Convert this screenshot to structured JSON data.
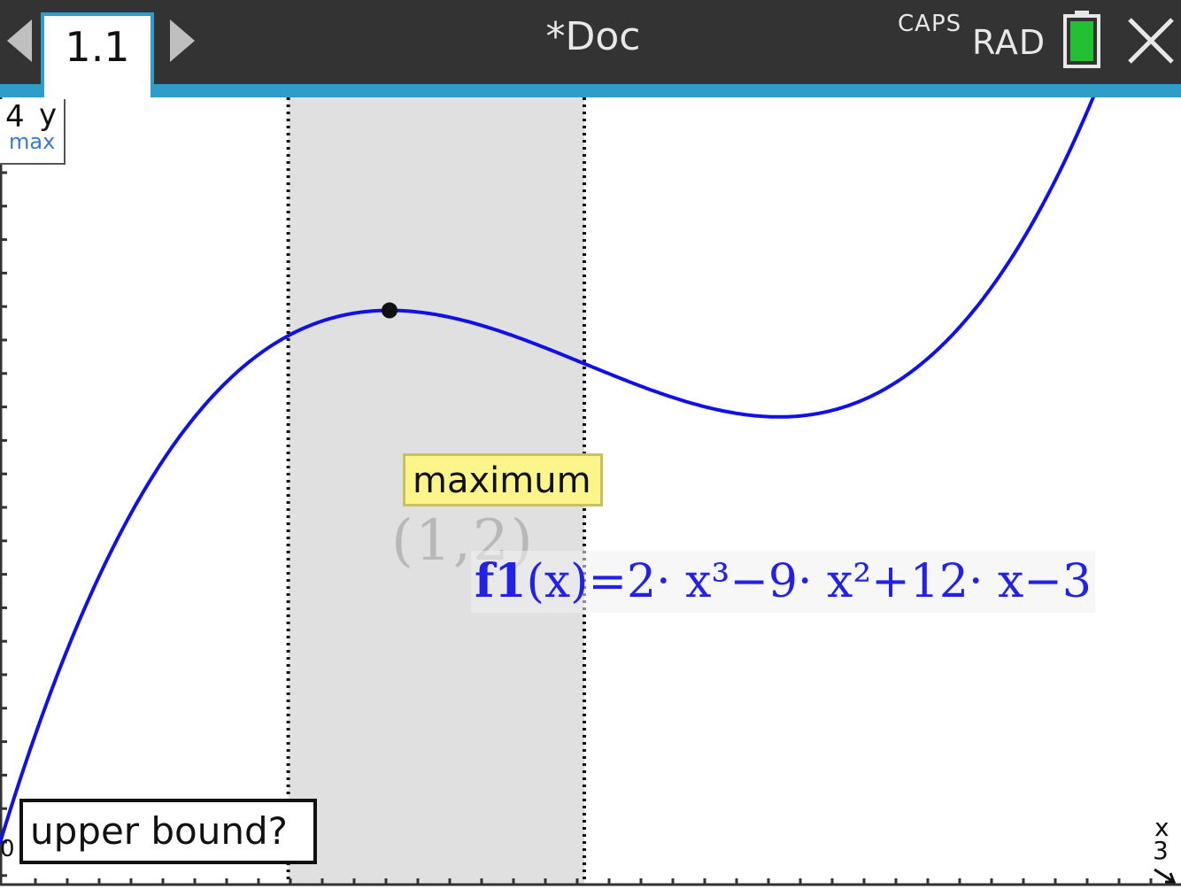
{
  "titlebar": {
    "tab_label": "1.1",
    "doc_title": "*Doc",
    "caps_indicator": "CAPS",
    "angle_mode": "RAD",
    "battery_color": "#22c033",
    "accent_color": "#2e9ec8"
  },
  "window": {
    "ymax_value": "4",
    "ymax_axis": "y",
    "ymax_caption": "max",
    "xmin_value": "0",
    "xmax_axis": "x",
    "xmax_value": "3"
  },
  "graph": {
    "function_name": "f1",
    "function_rest": "(x)=2· x³−9· x²+12· x−3",
    "curve_color": "#1010e8",
    "shading_color": "#e0e0e0",
    "max_label": "maximum",
    "max_point": "(1,2)",
    "prompt": "upper bound?"
  },
  "chart_data": {
    "type": "line",
    "title": "",
    "xlabel": "x",
    "ylabel": "y",
    "xlim": [
      0,
      3
    ],
    "ylim": [
      -3.4,
      4
    ],
    "series": [
      {
        "name": "f1(x)=2·x^3−9·x^2+12·x−3",
        "expression": "2x^3-9x^2+12x-3",
        "domain": [
          0,
          3
        ]
      }
    ],
    "shaded_interval": [
      0.74,
      1.5
    ],
    "marked_points": [
      {
        "label": "maximum",
        "x": 1,
        "y": 2
      }
    ]
  }
}
